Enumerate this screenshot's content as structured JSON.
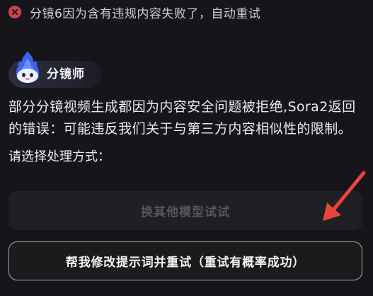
{
  "error": {
    "message": "分镜6因为含有违规内容失败了，自动重试",
    "icon": "close-icon",
    "color": "#c9454a"
  },
  "agent": {
    "name": "分镜师",
    "avatar_icon": "flame-ghost-avatar-icon"
  },
  "message": {
    "body": "部分分镜视频生成都因为内容安全问题被拒绝,Sora2返回的错误：可能违反我们关于与第三方内容相似性的限制。",
    "prompt": "请选择处理方式："
  },
  "actions": {
    "switch_model_label": "换其他模型试试",
    "switch_model_enabled": false,
    "retry_label": "帮我修改提示词并重试（重试有概率成功）",
    "retry_border_color": "#c99ca1"
  },
  "annotation": {
    "arrow_color": "#e8463c",
    "icon": "red-arrow-icon"
  }
}
